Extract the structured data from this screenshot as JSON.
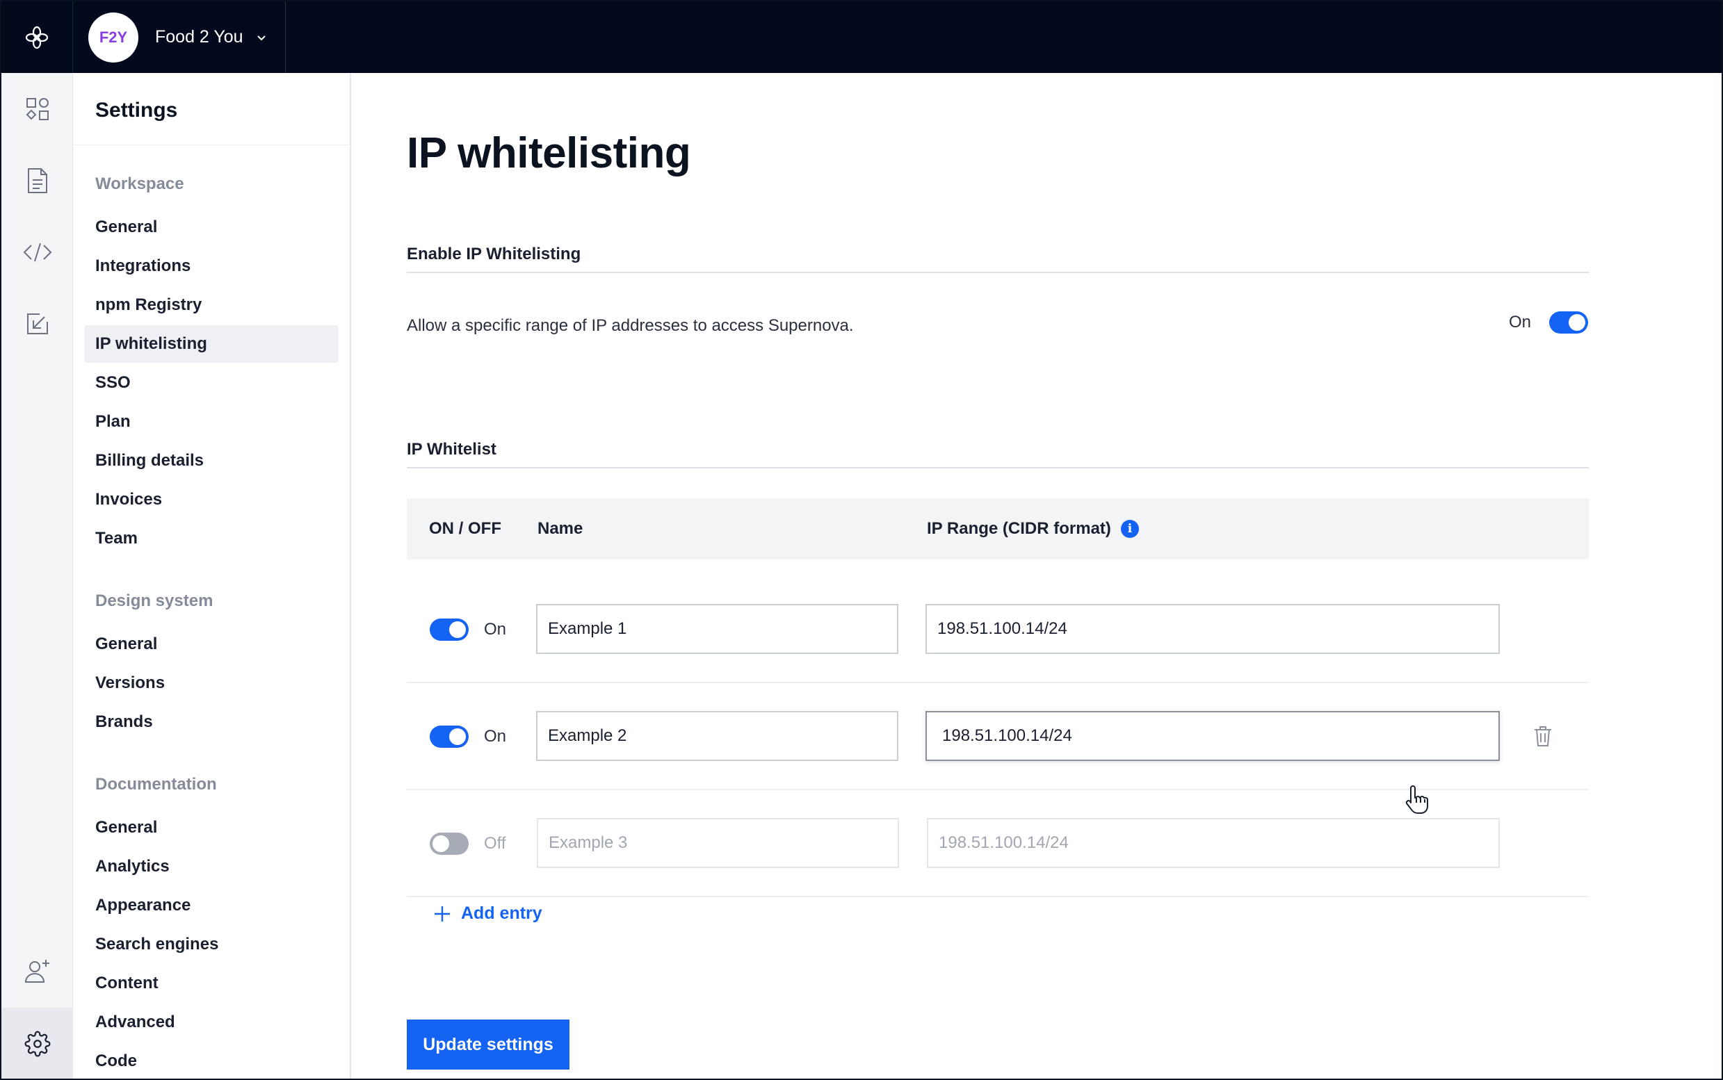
{
  "workspace": {
    "initials": "F2Y",
    "name": "Food 2 You"
  },
  "rail": {
    "icons": [
      "logo-icon",
      "components-icon",
      "document-icon",
      "code-icon",
      "import-icon",
      "add-user-icon",
      "gear-icon"
    ]
  },
  "nav": {
    "title": "Settings",
    "groups": [
      {
        "label": "Workspace",
        "items": [
          "General",
          "Integrations",
          "npm Registry",
          "IP whitelisting",
          "SSO",
          "Plan",
          "Billing details",
          "Invoices",
          "Team"
        ]
      },
      {
        "label": "Design system",
        "items": [
          "General",
          "Versions",
          "Brands"
        ]
      },
      {
        "label": "Documentation",
        "items": [
          "General",
          "Analytics",
          "Appearance",
          "Search engines",
          "Content",
          "Advanced",
          "Code"
        ]
      }
    ],
    "active": "IP whitelisting"
  },
  "main": {
    "title": "IP whitelisting",
    "enable_section": {
      "label": "Enable IP Whitelisting",
      "description": "Allow a specific range of IP addresses to access Supernova.",
      "toggle_label": "On",
      "enabled": true
    },
    "whitelist_section": {
      "label": "IP Whitelist",
      "columns": {
        "toggle": "ON / OFF",
        "name": "Name",
        "range": "IP Range (CIDR format)"
      },
      "info_icon": "info-icon",
      "rows": [
        {
          "state": "On",
          "enabled": true,
          "name": "Example 1",
          "range": "198.51.100.14/24"
        },
        {
          "state": "On",
          "enabled": true,
          "name": "Example 2",
          "range": "198.51.100.14/24"
        },
        {
          "state": "Off",
          "enabled": false,
          "name": "Example 3",
          "range": "198.51.100.14/24"
        }
      ],
      "add_entry_label": "Add entry"
    },
    "update_button": "Update settings"
  },
  "colors": {
    "accent": "#1463f3",
    "topbar": "#040a1e",
    "avatar_text": "#8b3fe0"
  }
}
